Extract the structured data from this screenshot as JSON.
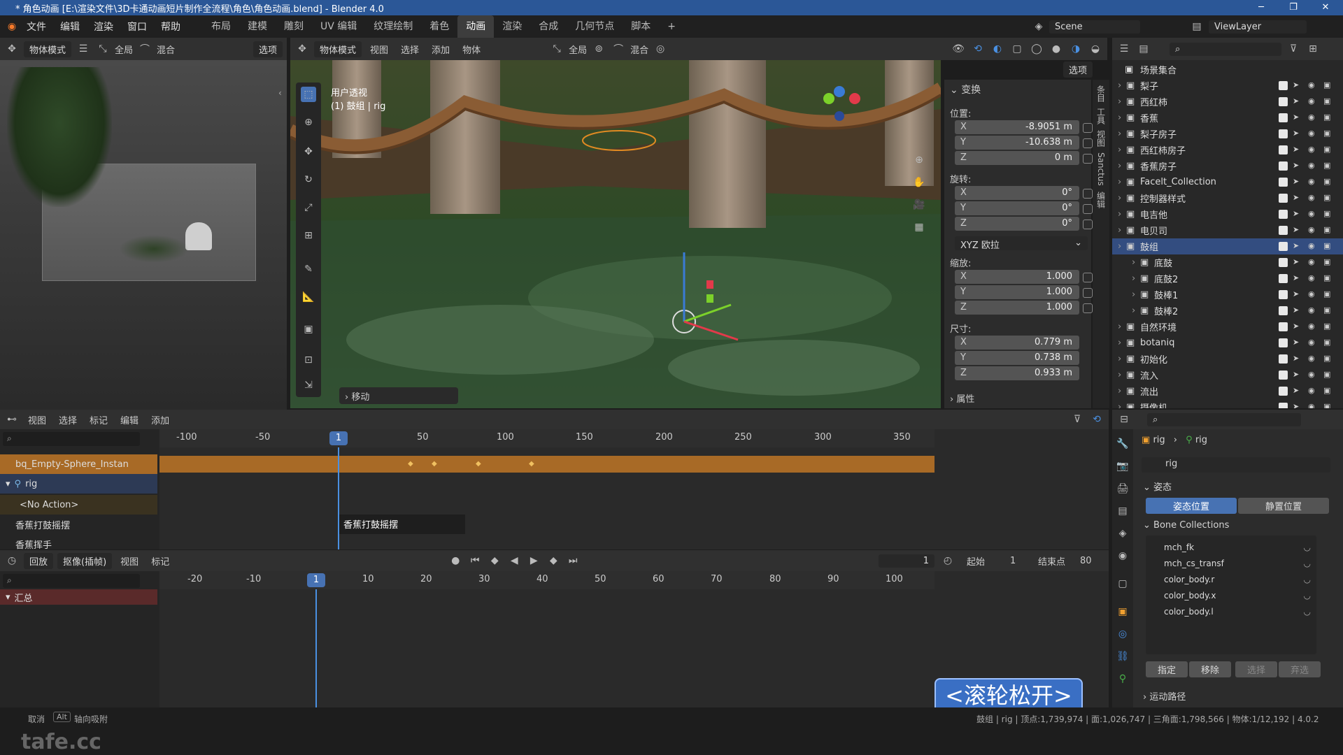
{
  "window": {
    "title": "* 角色动画 [E:\\渲染文件\\3D卡通动画短片制作全流程\\角色\\角色动画.blend] - Blender 4.0",
    "min": "─",
    "max": "❐",
    "close": "✕"
  },
  "menu": {
    "items": [
      "文件",
      "编辑",
      "渲染",
      "窗口",
      "帮助"
    ],
    "workspaces": [
      "布局",
      "建模",
      "雕刻",
      "UV 编辑",
      "纹理绘制",
      "着色",
      "动画",
      "渲染",
      "合成",
      "几何节点",
      "脚本"
    ],
    "plus": "+",
    "scene_label": "Scene",
    "viewlayer_label": "ViewLayer"
  },
  "left_header": {
    "mode": "物体模式",
    "transform": "全局",
    "blend": "混合",
    "options": "选项"
  },
  "main_header": {
    "mode": "物体模式",
    "menus": [
      "视图",
      "选择",
      "添加",
      "物体"
    ],
    "transform": "全局",
    "blend": "混合",
    "options": "选项"
  },
  "viewport": {
    "view_name": "用户透视",
    "collection_info": "(1) 鼓组 | rig",
    "last_op": "移动"
  },
  "npanel": {
    "title": "变换",
    "location_label": "位置:",
    "loc": [
      "-8.9051 m",
      "-10.638 m",
      "0 m"
    ],
    "rotation_label": "旋转:",
    "rot": [
      "0°",
      "0°",
      "0°"
    ],
    "rot_mode": "XYZ 欧拉",
    "scale_label": "缩放:",
    "scale": [
      "1.000",
      "1.000",
      "1.000"
    ],
    "dims_label": "尺寸:",
    "dims": [
      "0.779 m",
      "0.738 m",
      "0.933 m"
    ],
    "axes": [
      "X",
      "Y",
      "Z"
    ],
    "properties": "属性",
    "tabs": [
      "条目",
      "工具",
      "视图",
      "Sanctus",
      "编辑"
    ]
  },
  "outliner": {
    "root": "场景集合",
    "rows": [
      {
        "name": "梨子",
        "indent": 1
      },
      {
        "name": "西红柿",
        "indent": 1
      },
      {
        "name": "香蕉",
        "indent": 1
      },
      {
        "name": "梨子房子",
        "indent": 1
      },
      {
        "name": "西红柿房子",
        "indent": 1
      },
      {
        "name": "香蕉房子",
        "indent": 1
      },
      {
        "name": "Facelt_Collection",
        "indent": 1
      },
      {
        "name": "控制器样式",
        "indent": 1
      },
      {
        "name": "电吉他",
        "indent": 1
      },
      {
        "name": "电贝司",
        "indent": 1
      },
      {
        "name": "鼓组",
        "indent": 1
      },
      {
        "name": "底鼓",
        "indent": 2
      },
      {
        "name": "底鼓2",
        "indent": 2
      },
      {
        "name": "鼓棒1",
        "indent": 2
      },
      {
        "name": "鼓棒2",
        "indent": 2
      },
      {
        "name": "自然环境",
        "indent": 1
      },
      {
        "name": "botaniq",
        "indent": 1
      },
      {
        "name": "初始化",
        "indent": 1
      },
      {
        "name": "流入",
        "indent": 1
      },
      {
        "name": "流出",
        "indent": 1
      },
      {
        "name": "摄像机",
        "indent": 1
      }
    ]
  },
  "dopesheet": {
    "menus": [
      "视图",
      "选择",
      "标记",
      "编辑",
      "添加"
    ],
    "ticks": [
      "-100",
      "-50",
      "1",
      "50",
      "100",
      "150",
      "200",
      "250",
      "300",
      "350"
    ],
    "channels": [
      "bq_Empty-Sphere_Instan",
      "rig",
      "<No Action>",
      "香蕉打鼓摇摆",
      "香蕉挥手"
    ],
    "strip_label": "香蕉打鼓摇摆"
  },
  "timeline": {
    "menus": [
      "回放",
      "抠像(插帧)",
      "视图",
      "标记"
    ],
    "current_frame": "1",
    "start_label": "起始",
    "start": "1",
    "end_label": "结束点",
    "end": "80",
    "ticks": [
      "-20",
      "-10",
      "1",
      "10",
      "20",
      "30",
      "40",
      "50",
      "60",
      "70",
      "80",
      "90",
      "100"
    ],
    "summary": "汇总"
  },
  "props": {
    "breadcrumb": [
      "rig",
      "rig"
    ],
    "object_name": "rig",
    "pose_section": "姿态",
    "pose_position": "姿态位置",
    "rest_position": "静置位置",
    "bone_collections": "Bone Collections",
    "bones": [
      "mch_fk",
      "mch_cs_transf",
      "color_body.r",
      "color_body.x",
      "color_body.l"
    ],
    "assign": "指定",
    "remove": "移除",
    "select": "选择",
    "deselect": "弃选",
    "motion_paths": "运动路径"
  },
  "overlay": {
    "scroll_hint": "<滚轮松开>"
  },
  "status": {
    "cancel": "取消",
    "alt_key": "Alt",
    "snap": "轴向吸附",
    "stats": "鼓组 | rig | 顶点:1,739,974 | 面:1,026,747 | 三角面:1,798,566 | 物体:1/12,192 | 4.0.2",
    "watermark": "tafe.cc"
  }
}
